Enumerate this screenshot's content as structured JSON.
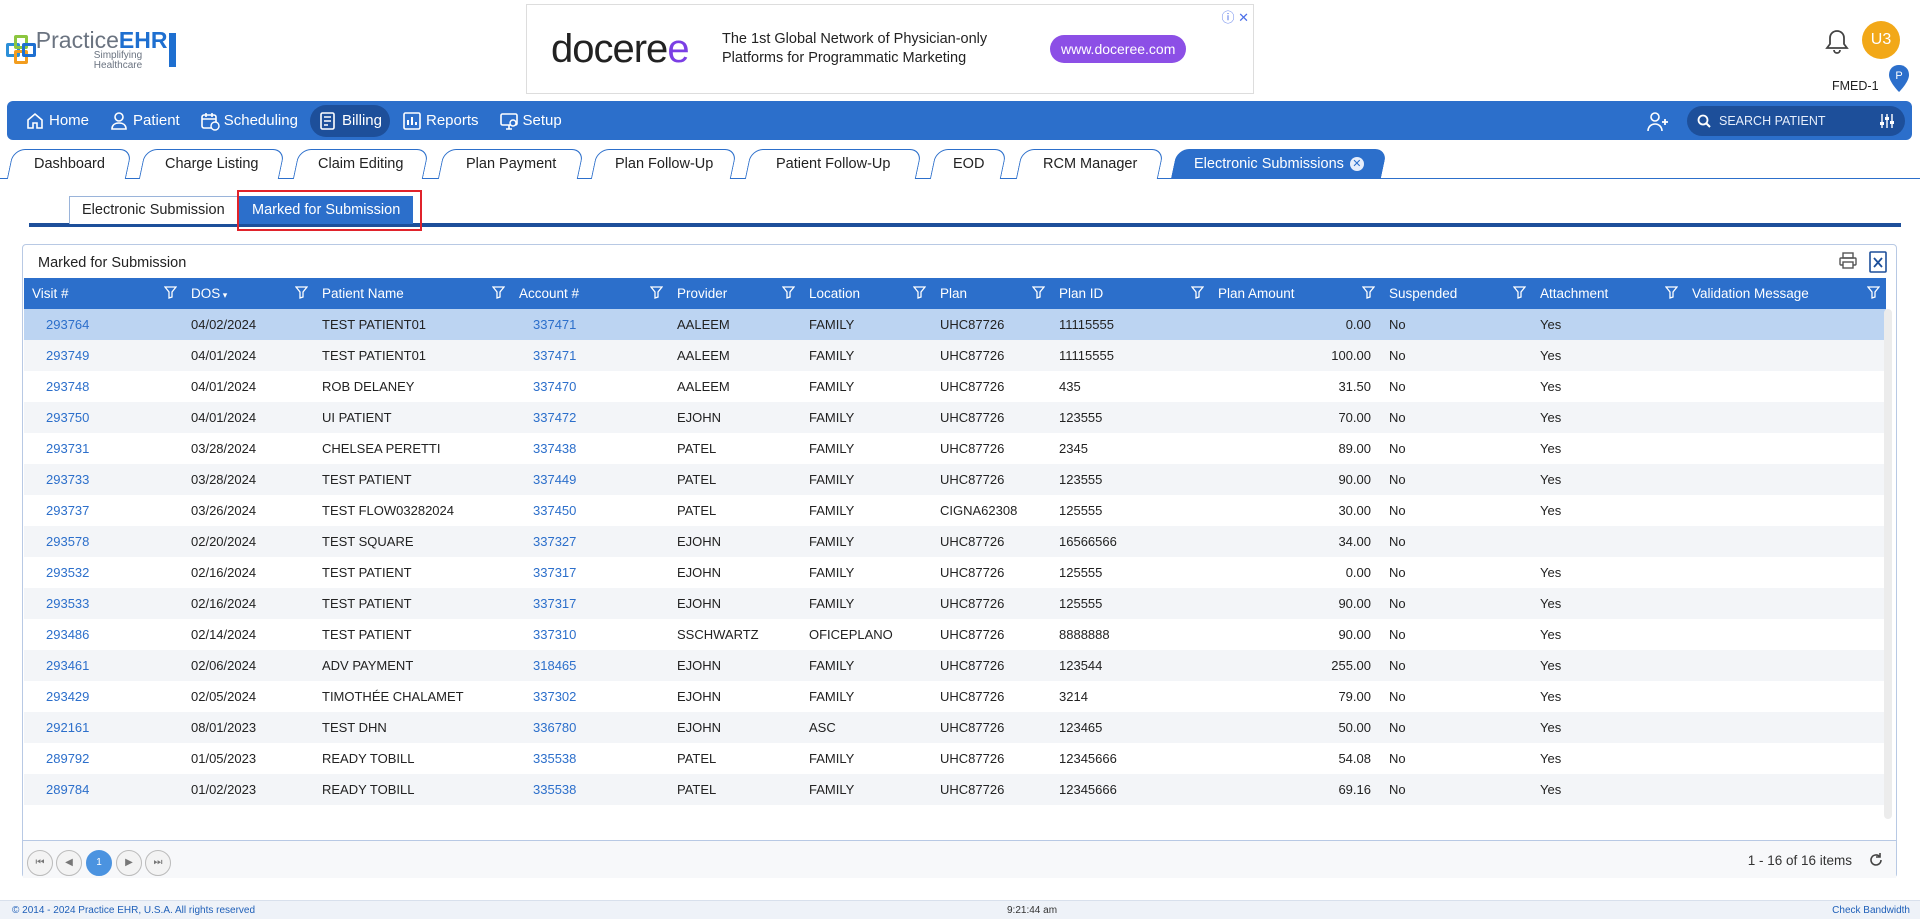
{
  "logo": {
    "name_prefix": "Practice",
    "name_suffix": "EHR",
    "tagline": "Simplifying Healthcare"
  },
  "ad": {
    "brand_prefix": "docere",
    "brand_suffix": "e",
    "line1": "The 1st Global Network of Physician-only",
    "line2": "Platforms for Programmatic Marketing",
    "cta": "www.doceree.com"
  },
  "user": {
    "initials": "U3",
    "facility": "FMED-1",
    "pin_label": "P"
  },
  "nav": {
    "items": [
      {
        "label": "Home",
        "icon": "home-icon"
      },
      {
        "label": "Patient",
        "icon": "patient-icon"
      },
      {
        "label": "Scheduling",
        "icon": "calendar-icon"
      },
      {
        "label": "Billing",
        "icon": "billing-icon"
      },
      {
        "label": "Reports",
        "icon": "reports-icon"
      },
      {
        "label": "Setup",
        "icon": "setup-icon"
      }
    ],
    "active": "Billing",
    "search_placeholder": "SEARCH PATIENT"
  },
  "tabs": {
    "items": [
      "Dashboard",
      "Charge Listing",
      "Claim Editing",
      "Plan Payment",
      "Plan Follow-Up",
      "Patient Follow-Up",
      "EOD",
      "RCM Manager",
      "Electronic Submissions"
    ],
    "active": "Electronic Submissions"
  },
  "subtabs": {
    "items": [
      "Electronic Submission",
      "Marked for Submission"
    ],
    "active": "Marked for Submission"
  },
  "grid": {
    "title": "Marked for Submission",
    "columns": [
      "Visit #",
      "DOS",
      "Patient Name",
      "Account #",
      "Provider",
      "Location",
      "Plan",
      "Plan ID",
      "Plan Amount",
      "Suspended",
      "Attachment",
      "Validation Message"
    ],
    "rows": [
      [
        "293764",
        "04/02/2024",
        "TEST PATIENT01",
        "337471",
        "AALEEM",
        "FAMILY",
        "UHC87726",
        "11115555",
        "0.00",
        "No",
        "Yes",
        ""
      ],
      [
        "293749",
        "04/01/2024",
        "TEST PATIENT01",
        "337471",
        "AALEEM",
        "FAMILY",
        "UHC87726",
        "11115555",
        "100.00",
        "No",
        "Yes",
        ""
      ],
      [
        "293748",
        "04/01/2024",
        "ROB DELANEY",
        "337470",
        "AALEEM",
        "FAMILY",
        "UHC87726",
        "435",
        "31.50",
        "No",
        "Yes",
        ""
      ],
      [
        "293750",
        "04/01/2024",
        "UI PATIENT",
        "337472",
        "EJOHN",
        "FAMILY",
        "UHC87726",
        "123555",
        "70.00",
        "No",
        "Yes",
        ""
      ],
      [
        "293731",
        "03/28/2024",
        "CHELSEA PERETTI",
        "337438",
        "PATEL",
        "FAMILY",
        "UHC87726",
        "2345",
        "89.00",
        "No",
        "Yes",
        ""
      ],
      [
        "293733",
        "03/28/2024",
        "TEST PATIENT",
        "337449",
        "PATEL",
        "FAMILY",
        "UHC87726",
        "123555",
        "90.00",
        "No",
        "Yes",
        ""
      ],
      [
        "293737",
        "03/26/2024",
        "TEST FLOW03282024",
        "337450",
        "PATEL",
        "FAMILY",
        "CIGNA62308",
        "125555",
        "30.00",
        "No",
        "Yes",
        ""
      ],
      [
        "293578",
        "02/20/2024",
        "TEST SQUARE",
        "337327",
        "EJOHN",
        "FAMILY",
        "UHC87726",
        "16566566",
        "34.00",
        "No",
        "",
        ""
      ],
      [
        "293532",
        "02/16/2024",
        "TEST PATIENT",
        "337317",
        "EJOHN",
        "FAMILY",
        "UHC87726",
        "125555",
        "0.00",
        "No",
        "Yes",
        ""
      ],
      [
        "293533",
        "02/16/2024",
        "TEST PATIENT",
        "337317",
        "EJOHN",
        "FAMILY",
        "UHC87726",
        "125555",
        "90.00",
        "No",
        "Yes",
        ""
      ],
      [
        "293486",
        "02/14/2024",
        "TEST PATIENT",
        "337310",
        "SSCHWARTZ",
        "OFICEPLANO",
        "UHC87726",
        "8888888",
        "90.00",
        "No",
        "Yes",
        ""
      ],
      [
        "293461",
        "02/06/2024",
        "ADV PAYMENT",
        "318465",
        "EJOHN",
        "FAMILY",
        "UHC87726",
        "123544",
        "255.00",
        "No",
        "Yes",
        ""
      ],
      [
        "293429",
        "02/05/2024",
        "TIMOTHÉE CHALAMET",
        "337302",
        "EJOHN",
        "FAMILY",
        "UHC87726",
        "3214",
        "79.00",
        "No",
        "Yes",
        ""
      ],
      [
        "292161",
        "08/01/2023",
        "TEST DHN",
        "336780",
        "EJOHN",
        "ASC",
        "UHC87726",
        "123465",
        "50.00",
        "No",
        "Yes",
        ""
      ],
      [
        "289792",
        "01/05/2023",
        "READY TOBILL",
        "335538",
        "PATEL",
        "FAMILY",
        "UHC87726",
        "12345666",
        "54.08",
        "No",
        "Yes",
        ""
      ],
      [
        "289784",
        "01/02/2023",
        "READY TOBILL",
        "335538",
        "PATEL",
        "FAMILY",
        "UHC87726",
        "12345666",
        "69.16",
        "No",
        "Yes",
        ""
      ]
    ],
    "selected_row": 0,
    "pager": {
      "current_page": "1",
      "info": "1 - 16 of 16 items"
    }
  },
  "footer": {
    "copyright": "© 2014 - 2024 Practice EHR, U.S.A. All rights reserved",
    "time": "9:21:44 am",
    "bandwidth": "Check Bandwidth"
  },
  "colors": {
    "primary": "#2c6fcb",
    "dark": "#1d4f9a",
    "highlight": "#e0232b",
    "avatar": "#f2a818"
  }
}
